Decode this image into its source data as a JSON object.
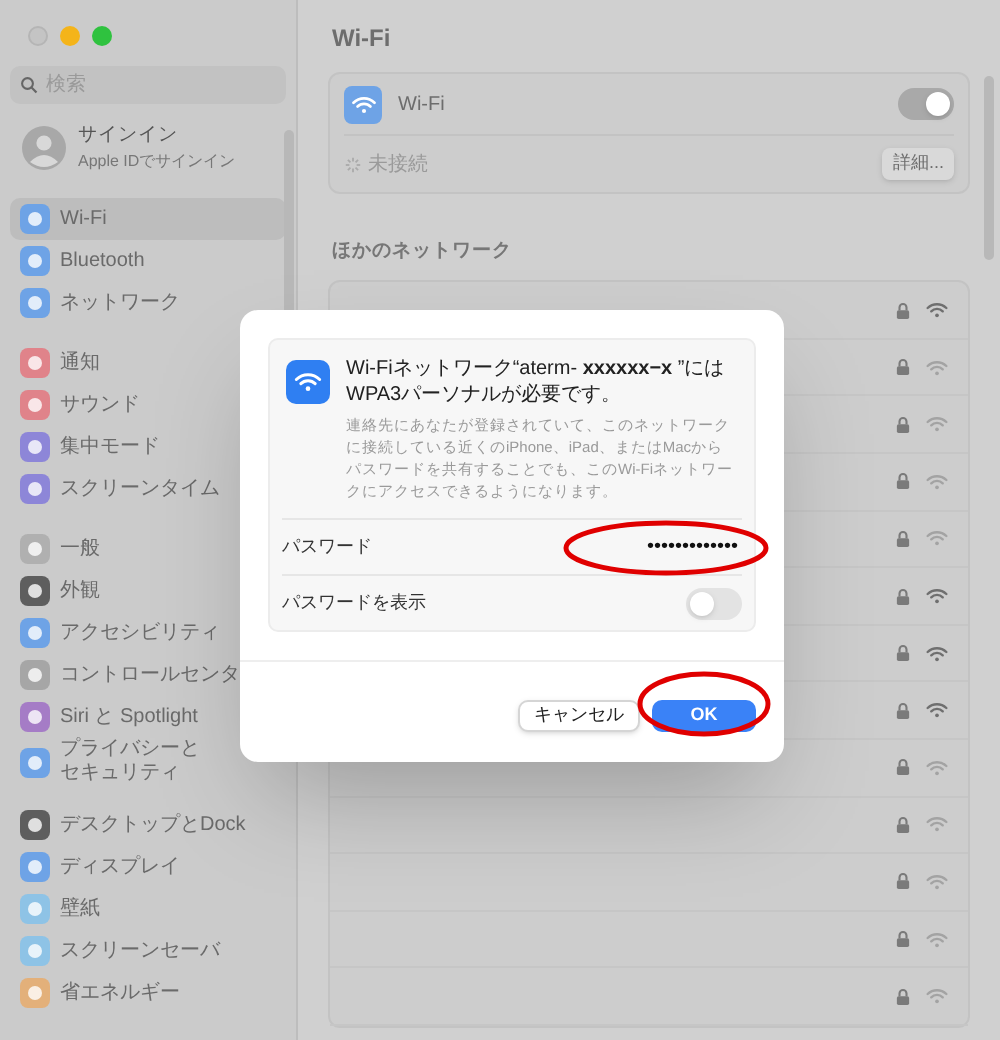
{
  "sidebar": {
    "search": {
      "placeholder": "検索"
    },
    "account": {
      "name": "サインイン",
      "subtitle": "Apple IDでサインイン"
    },
    "groups": [
      [
        {
          "label": "Wi-Fi",
          "selected": true,
          "color": "#6ea3e6"
        },
        {
          "label": "Bluetooth",
          "selected": false,
          "color": "#6ea3e6"
        },
        {
          "label": "ネットワーク",
          "selected": false,
          "color": "#6ea3e6"
        }
      ],
      [
        {
          "label": "通知",
          "selected": false,
          "color": "#e0838a"
        },
        {
          "label": "サウンド",
          "selected": false,
          "color": "#e0838a"
        },
        {
          "label": "集中モード",
          "selected": false,
          "color": "#8d86d8"
        },
        {
          "label": "スクリーンタイム",
          "selected": false,
          "color": "#8d86d8"
        }
      ],
      [
        {
          "label": "一般",
          "selected": false,
          "color": "#b0b0b0"
        },
        {
          "label": "外観",
          "selected": false,
          "color": "#5e5e5e"
        },
        {
          "label": "アクセシビリティ",
          "selected": false,
          "color": "#6ea3e6"
        },
        {
          "label": "コントロールセンタ",
          "selected": false,
          "color": "#a6a6a6"
        },
        {
          "label": "Siri と Spotlight",
          "selected": false,
          "color": "#a57cc6"
        },
        {
          "label": "プライバシーとセキュリティ",
          "selected": false,
          "color": "#6ea3e6"
        }
      ],
      [
        {
          "label": "デスクトップとDock",
          "selected": false,
          "color": "#5e5e5e"
        },
        {
          "label": "ディスプレイ",
          "selected": false,
          "color": "#6ea3e6"
        },
        {
          "label": "壁紙",
          "selected": false,
          "color": "#8ec3e6"
        },
        {
          "label": "スクリーンセーバ",
          "selected": false,
          "color": "#8ec3e6"
        },
        {
          "label": "省エネルギー",
          "selected": false,
          "color": "#e3b07a"
        }
      ]
    ]
  },
  "main": {
    "title": "Wi-Fi",
    "wifi": {
      "label": "Wi-Fi",
      "on": true,
      "status": "未接続",
      "details_button": "詳細..."
    },
    "other_networks": {
      "heading": "ほかのネットワーク",
      "rows": [
        {
          "strong": true
        },
        {
          "strong": false
        },
        {
          "strong": false
        },
        {
          "strong": false
        },
        {
          "strong": false
        },
        {
          "strong": true
        },
        {
          "strong": true
        },
        {
          "strong": true
        },
        {
          "strong": false
        },
        {
          "strong": false
        },
        {
          "strong": false
        },
        {
          "strong": false
        },
        {
          "strong": false
        }
      ]
    }
  },
  "dialog": {
    "title": "Wi-Fiネットワーク“aterm- **xxxxxx−x** ”にはWPA3パーソナルが必要です。",
    "message": "連絡先にあなたが登録されていて、このネットワークに接続している近くのiPhone、iPad、またはMacからパスワードを共有することでも、このWi-Fiネットワークにアクセスできるようになります。",
    "password": {
      "label": "パスワード",
      "value": "•••••••••••••",
      "highlighted": true
    },
    "show_password": {
      "label": "パスワードを表示",
      "on": false
    },
    "buttons": [
      {
        "label": "キャンセル",
        "kind": "secondary",
        "highlighted": false
      },
      {
        "label": "OK",
        "kind": "primary",
        "highlighted": true
      }
    ]
  }
}
